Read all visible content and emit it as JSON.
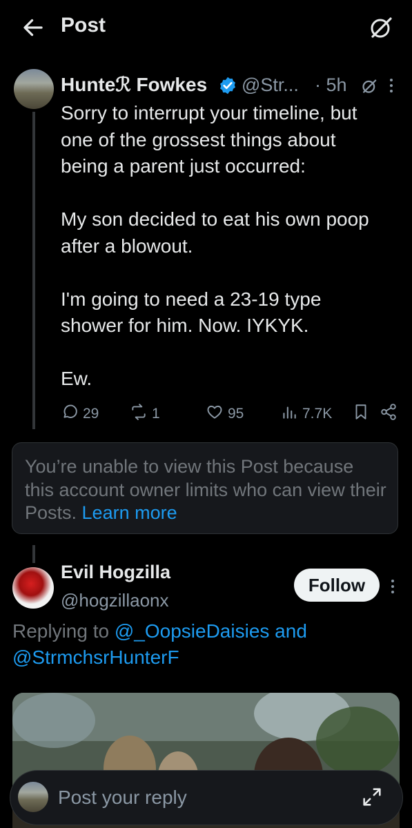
{
  "header": {
    "title": "Post"
  },
  "post": {
    "author_name": "Hunteℛ Fowkes",
    "handle": "@Str...",
    "time": "· 5h",
    "body": "Sorry to interrupt your timeline, but\none of the grossest things about\nbeing a parent just occurred:\n\nMy son decided to eat his own poop\nafter a blowout.\n\nI'm going to need a 23-19 type\nshower for him. Now. IYKYK.\n\nEw.",
    "stats": {
      "replies": "29",
      "reposts": "1",
      "likes": "95",
      "views": "7.7K"
    }
  },
  "limited_notice": {
    "text": "You’re unable to view this Post because this account owner limits who can view their Posts. ",
    "link": "Learn more"
  },
  "reply": {
    "author_name": "Evil Hogzilla",
    "handle": "@hogzillaonx",
    "follow_label": "Follow",
    "replying_prefix": "Replying to ",
    "mention1": "@_OopsieDaisies",
    "conj": " and",
    "mention2": "@StrmchsrHunterF"
  },
  "composer": {
    "placeholder": "Post your reply"
  },
  "icons": [
    "back-arrow-icon",
    "grok-icon",
    "verified-badge-icon",
    "more-icon",
    "reply-icon",
    "repost-icon",
    "like-icon",
    "views-icon",
    "bookmark-icon",
    "share-icon",
    "expand-icon"
  ],
  "colors": {
    "accent": "#1d9bf0",
    "background": "#000000",
    "muted": "#71767b"
  }
}
